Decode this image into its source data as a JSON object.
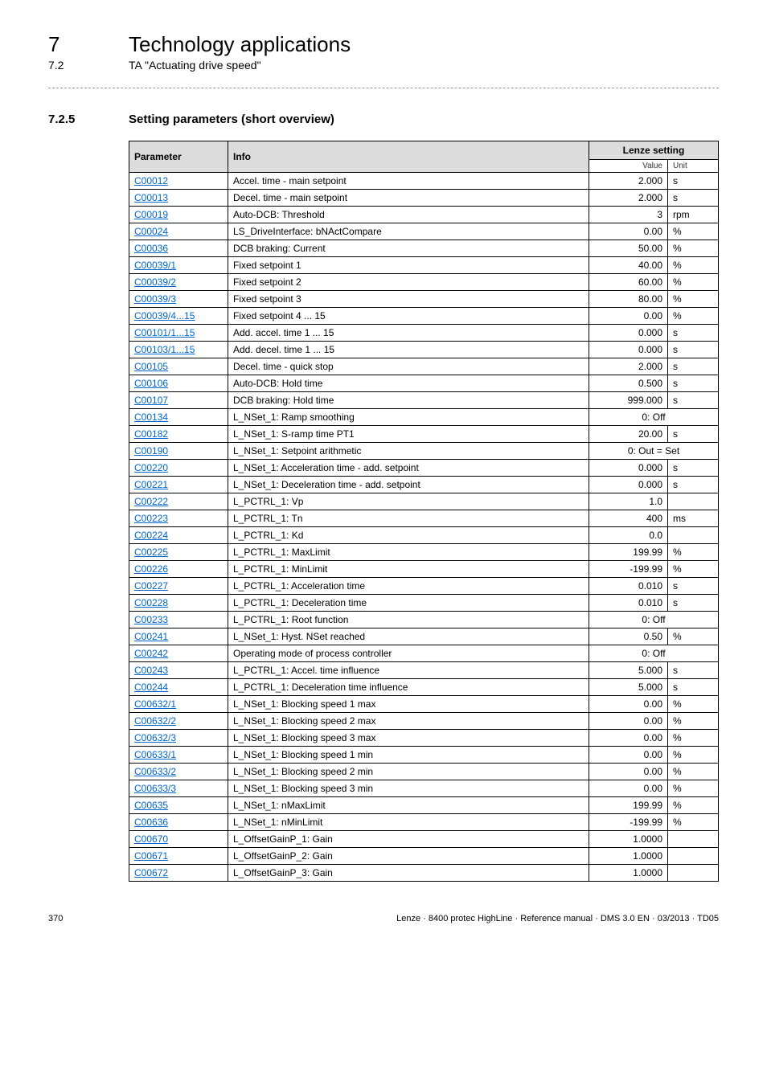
{
  "header": {
    "chapter_num": "7",
    "chapter_title": "Technology applications",
    "sub_num": "7.2",
    "sub_title": "TA \"Actuating drive speed\""
  },
  "section": {
    "num": "7.2.5",
    "title": "Setting parameters (short overview)"
  },
  "table": {
    "headers": {
      "parameter": "Parameter",
      "info": "Info",
      "lenze": "Lenze setting"
    },
    "subheaders": {
      "value": "Value",
      "unit": "Unit"
    },
    "rows": [
      {
        "param": "C00012",
        "info": "Accel. time - main setpoint",
        "value": "2.000",
        "unit": "s"
      },
      {
        "param": "C00013",
        "info": "Decel. time - main setpoint",
        "value": "2.000",
        "unit": "s"
      },
      {
        "param": "C00019",
        "info": "Auto-DCB: Threshold",
        "value": "3",
        "unit": "rpm"
      },
      {
        "param": "C00024",
        "info": "LS_DriveInterface: bNActCompare",
        "value": "0.00",
        "unit": "%"
      },
      {
        "param": "C00036",
        "info": "DCB braking: Current",
        "value": "50.00",
        "unit": "%"
      },
      {
        "param": "C00039/1",
        "info": "Fixed setpoint 1",
        "value": "40.00",
        "unit": "%"
      },
      {
        "param": "C00039/2",
        "info": "Fixed setpoint 2",
        "value": "60.00",
        "unit": "%"
      },
      {
        "param": "C00039/3",
        "info": "Fixed setpoint 3",
        "value": "80.00",
        "unit": "%"
      },
      {
        "param": "C00039/4...15",
        "info": "Fixed setpoint 4 ... 15",
        "value": "0.00",
        "unit": "%"
      },
      {
        "param": "C00101/1...15",
        "info": "Add. accel. time 1 ... 15",
        "value": "0.000",
        "unit": "s"
      },
      {
        "param": "C00103/1...15",
        "info": "Add. decel. time 1 ... 15",
        "value": "0.000",
        "unit": "s"
      },
      {
        "param": "C00105",
        "info": "Decel. time - quick stop",
        "value": "2.000",
        "unit": "s"
      },
      {
        "param": "C00106",
        "info": "Auto-DCB: Hold time",
        "value": "0.500",
        "unit": "s"
      },
      {
        "param": "C00107",
        "info": "DCB braking: Hold time",
        "value": "999.000",
        "unit": "s"
      },
      {
        "param": "C00134",
        "info": "L_NSet_1: Ramp smoothing",
        "value_span": "0: Off"
      },
      {
        "param": "C00182",
        "info": "L_NSet_1: S-ramp time PT1",
        "value": "20.00",
        "unit": "s"
      },
      {
        "param": "C00190",
        "info": "L_NSet_1: Setpoint arithmetic",
        "value_span": "0: Out = Set"
      },
      {
        "param": "C00220",
        "info": "L_NSet_1: Acceleration time - add. setpoint",
        "value": "0.000",
        "unit": "s"
      },
      {
        "param": "C00221",
        "info": "L_NSet_1: Deceleration time - add. setpoint",
        "value": "0.000",
        "unit": "s"
      },
      {
        "param": "C00222",
        "info": "L_PCTRL_1: Vp",
        "value": "1.0",
        "unit": ""
      },
      {
        "param": "C00223",
        "info": "L_PCTRL_1: Tn",
        "value": "400",
        "unit": "ms"
      },
      {
        "param": "C00224",
        "info": "L_PCTRL_1: Kd",
        "value": "0.0",
        "unit": ""
      },
      {
        "param": "C00225",
        "info": "L_PCTRL_1: MaxLimit",
        "value": "199.99",
        "unit": "%"
      },
      {
        "param": "C00226",
        "info": "L_PCTRL_1: MinLimit",
        "value": "-199.99",
        "unit": "%"
      },
      {
        "param": "C00227",
        "info": "L_PCTRL_1: Acceleration time",
        "value": "0.010",
        "unit": "s"
      },
      {
        "param": "C00228",
        "info": "L_PCTRL_1: Deceleration time",
        "value": "0.010",
        "unit": "s"
      },
      {
        "param": "C00233",
        "info": "L_PCTRL_1: Root function",
        "value_span": "0: Off"
      },
      {
        "param": "C00241",
        "info": "L_NSet_1: Hyst. NSet reached",
        "value": "0.50",
        "unit": "%"
      },
      {
        "param": "C00242",
        "info": "Operating mode of process controller",
        "value_span": "0: Off"
      },
      {
        "param": "C00243",
        "info": "L_PCTRL_1: Accel. time influence",
        "value": "5.000",
        "unit": "s"
      },
      {
        "param": "C00244",
        "info": "L_PCTRL_1: Deceleration time influence",
        "value": "5.000",
        "unit": "s"
      },
      {
        "param": "C00632/1",
        "info": "L_NSet_1: Blocking speed 1 max",
        "value": "0.00",
        "unit": "%"
      },
      {
        "param": "C00632/2",
        "info": "L_NSet_1: Blocking speed 2 max",
        "value": "0.00",
        "unit": "%"
      },
      {
        "param": "C00632/3",
        "info": "L_NSet_1: Blocking speed 3 max",
        "value": "0.00",
        "unit": "%"
      },
      {
        "param": "C00633/1",
        "info": "L_NSet_1: Blocking speed 1 min",
        "value": "0.00",
        "unit": "%"
      },
      {
        "param": "C00633/2",
        "info": "L_NSet_1: Blocking speed 2 min",
        "value": "0.00",
        "unit": "%"
      },
      {
        "param": "C00633/3",
        "info": "L_NSet_1: Blocking speed 3 min",
        "value": "0.00",
        "unit": "%"
      },
      {
        "param": "C00635",
        "info": "L_NSet_1: nMaxLimit",
        "value": "199.99",
        "unit": "%"
      },
      {
        "param": "C00636",
        "info": "L_NSet_1: nMinLimit",
        "value": "-199.99",
        "unit": "%"
      },
      {
        "param": "C00670",
        "info": "L_OffsetGainP_1: Gain",
        "value": "1.0000",
        "unit": ""
      },
      {
        "param": "C00671",
        "info": "L_OffsetGainP_2: Gain",
        "value": "1.0000",
        "unit": ""
      },
      {
        "param": "C00672",
        "info": "L_OffsetGainP_3: Gain",
        "value": "1.0000",
        "unit": ""
      }
    ]
  },
  "footer": {
    "page": "370",
    "ref": "Lenze · 8400 protec HighLine · Reference manual · DMS 3.0 EN · 03/2013 · TD05"
  }
}
